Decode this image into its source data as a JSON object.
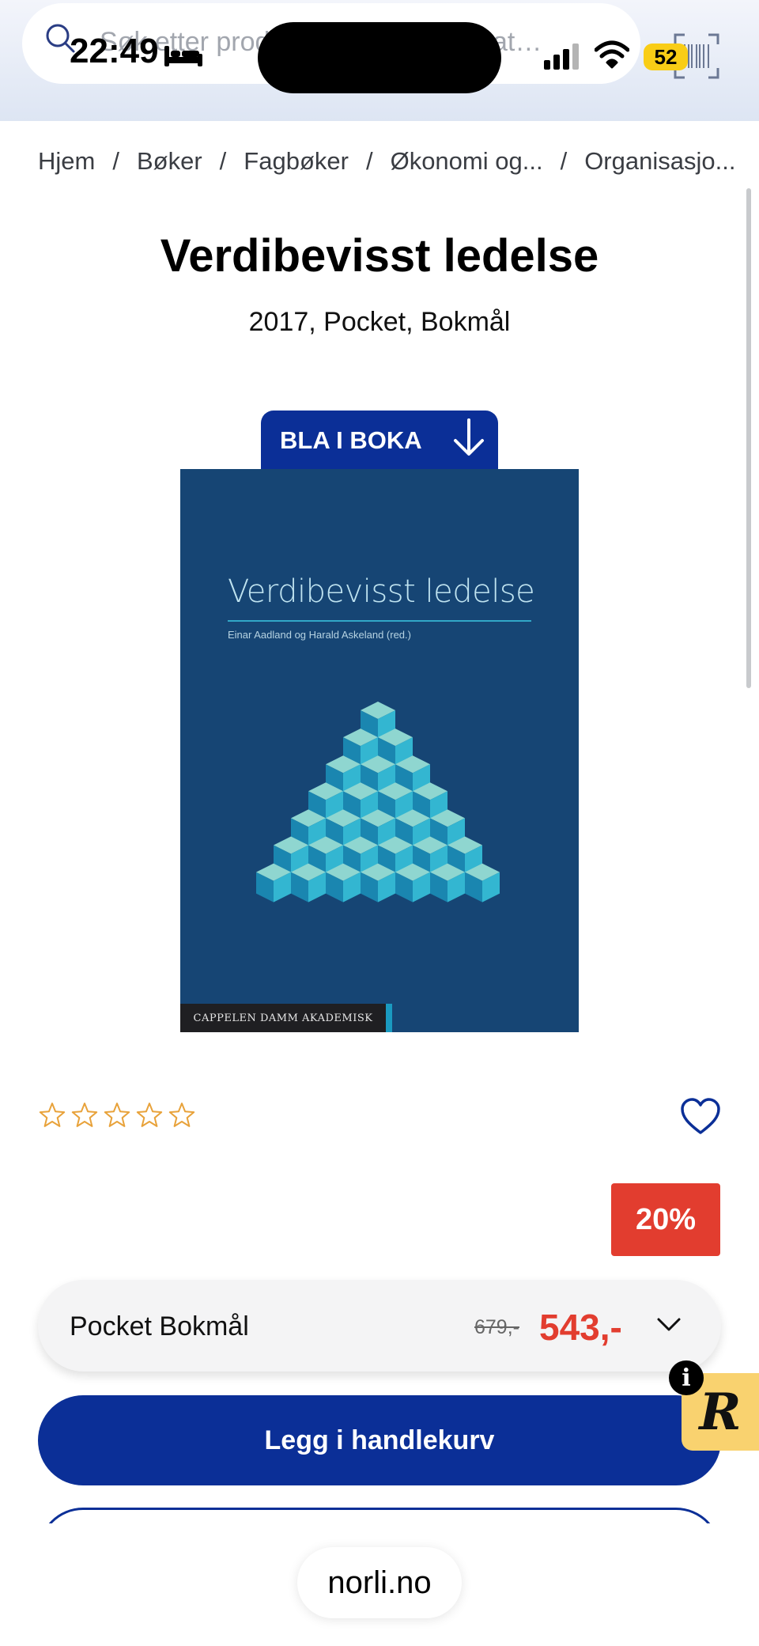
{
  "status_bar": {
    "time": "22:49",
    "battery": "52"
  },
  "search": {
    "placeholder": "Søk etter produkt, forfatter eller kategori"
  },
  "breadcrumb": [
    "Hjem",
    "Bøker",
    "Fagbøker",
    "Økonomi og...",
    "Organisasjo..."
  ],
  "product": {
    "title": "Verdibevisst ledelse",
    "details": "2017, Pocket, Bokmål",
    "preview_label": "BLA I BOKA",
    "cover": {
      "title": "Verdibevisst ledelse",
      "authors": "Einar Aadland og Harald Askeland (red.)",
      "publisher": "CAPPELEN DAMM AKADEMISK",
      "background_color": "#164574"
    },
    "rating": 0,
    "rating_max": 5,
    "discount": "20%",
    "variant": {
      "label": "Pocket Bokmål",
      "old_price": "679,-",
      "price": "543,-"
    },
    "add_to_cart_label": "Legg i handlekurv"
  },
  "widget": {
    "letter": "R",
    "info": "i"
  },
  "browser": {
    "domain": "norli.no"
  },
  "colors": {
    "brand": "#0b2f97",
    "sale": "#e23d2f",
    "star": "#e8a23a"
  }
}
